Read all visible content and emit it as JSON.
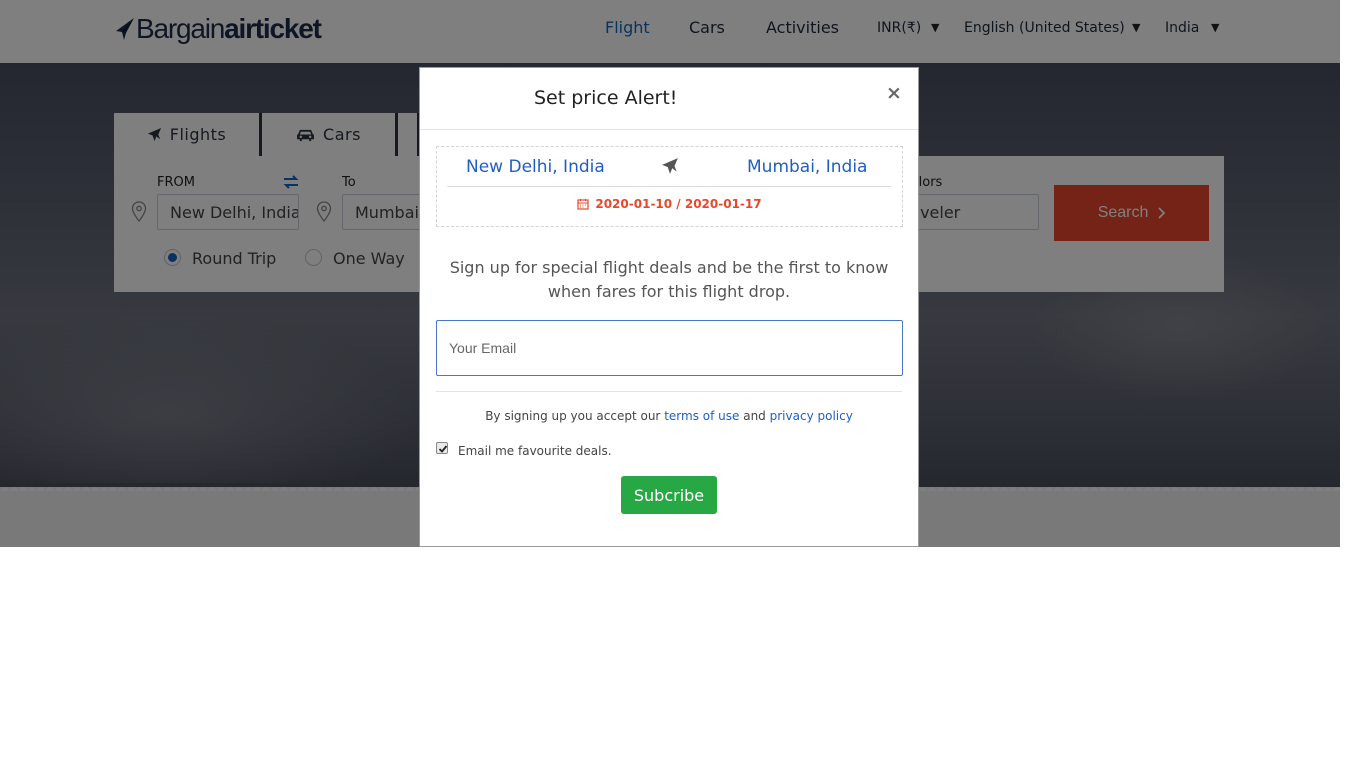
{
  "logo": {
    "prefix": "Bargain",
    "bold": "airticket"
  },
  "nav": {
    "flight": "Flight",
    "cars": "Cars",
    "activities": "Activities",
    "currency": "INR(₹)",
    "language": "English (United States)",
    "country": "India"
  },
  "search": {
    "tabs": {
      "flights": "Flights",
      "cars": "Cars"
    },
    "from_label": "FROM",
    "to_label": "To",
    "from_value": "New Delhi, India",
    "to_value": "Mumbai, India",
    "travellers_label": "Travellors",
    "travellers_value": "1 Traveler",
    "trip_types": {
      "round": "Round Trip",
      "oneway": "One Way"
    },
    "selected_trip": "round",
    "search_button": "Search"
  },
  "modal": {
    "title": "Set price Alert!",
    "close": "×",
    "route": {
      "from": "New Delhi, India",
      "to": "Mumbai, India",
      "dates": "2020-01-10 / 2020-01-17"
    },
    "signup_text": "Sign up for special flight deals and be the first to know when fares for this flight drop.",
    "email_placeholder": "Your Email",
    "terms_prefix": "By signing up you accept our",
    "terms_link": "terms of use",
    "terms_and": "and",
    "privacy_link": "privacy policy",
    "checkbox_label": "Email me favourite deals.",
    "checkbox_checked": true,
    "subscribe_button": "Subcribe"
  },
  "colors": {
    "accent_blue": "#1565c0",
    "search_red": "#e8472c",
    "subscribe_green": "#28a745"
  },
  "icons": [
    "logo-plane-icon",
    "plane-icon",
    "car-icon",
    "swap-icon",
    "location-pin-icon",
    "calendar-icon",
    "chevron-right-icon",
    "check-icon"
  ]
}
